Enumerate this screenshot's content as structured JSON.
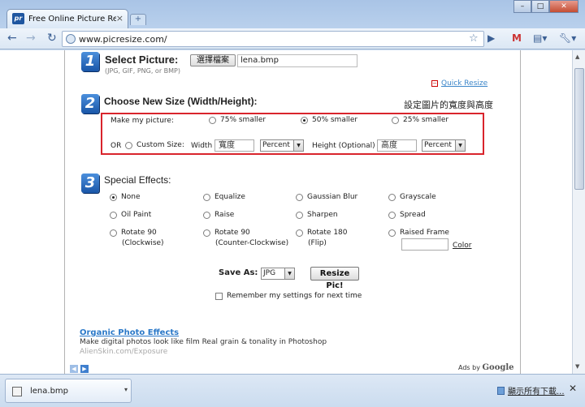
{
  "browser": {
    "tab_title": "Free Online Picture Resi...",
    "tab_close": "×",
    "new_tab": "+",
    "url": "www.picresize.com/",
    "win_min": "–",
    "win_max": "□",
    "win_close": "✕"
  },
  "step1": {
    "number": "1",
    "title": "Select Picture:",
    "formats": "(JPG, GIF, PNG, or BMP)",
    "choose_file": "選擇檔案",
    "file_name": "lena.bmp"
  },
  "quick_resize": {
    "icon": "−",
    "label": "Quick Resize"
  },
  "step2": {
    "number": "2",
    "title": "Choose New Size (Width/Height):",
    "annotation": "設定圖片的寬度與高度",
    "make_my_picture": "Make my picture:",
    "options": [
      {
        "label": "75% smaller",
        "selected": false
      },
      {
        "label": "50% smaller",
        "selected": true
      },
      {
        "label": "25% smaller",
        "selected": false
      }
    ],
    "or": "OR",
    "custom_size": "Custom Size:",
    "width_label": "Width",
    "width_value": "寬度",
    "width_unit": "Percent",
    "height_label": "Height (Optional)",
    "height_value": "高度",
    "height_unit": "Percent"
  },
  "step3": {
    "number": "3",
    "title": "Special Effects:",
    "effects": [
      {
        "label": "None",
        "selected": true
      },
      {
        "label": "Equalize",
        "selected": false
      },
      {
        "label": "Gaussian Blur",
        "selected": false
      },
      {
        "label": "Grayscale",
        "selected": false
      },
      {
        "label": "Oil Paint",
        "selected": false
      },
      {
        "label": "Raise",
        "selected": false
      },
      {
        "label": "Sharpen",
        "selected": false
      },
      {
        "label": "Spread",
        "selected": false
      },
      {
        "label": "Rotate 90",
        "sub": "(Clockwise)",
        "selected": false
      },
      {
        "label": "Rotate 90",
        "sub": "(Counter-Clockwise)",
        "selected": false
      },
      {
        "label": "Rotate 180",
        "sub": "(Flip)",
        "selected": false
      },
      {
        "label": "Raised Frame",
        "selected": false
      }
    ],
    "color_link": "Color"
  },
  "save": {
    "label": "Save As:",
    "format": "JPG",
    "resize_button": "Resize Pic!",
    "remember": "Remember my settings for next time",
    "remember_checked": false
  },
  "ad": {
    "title": "Organic Photo Effects",
    "description": "Make digital photos look like film Real grain & tonality in Photoshop",
    "url": "AlienSkin.com/Exposure",
    "ads_by": "Ads by",
    "google": "Google"
  },
  "downloads": {
    "file_name": "lena.bmp",
    "show_all": "顯示所有下載...",
    "close": "✕"
  },
  "colors": {
    "accent_link": "#3c86c9",
    "highlight_box": "#d9242c",
    "step_badge": "#1a56a8"
  }
}
